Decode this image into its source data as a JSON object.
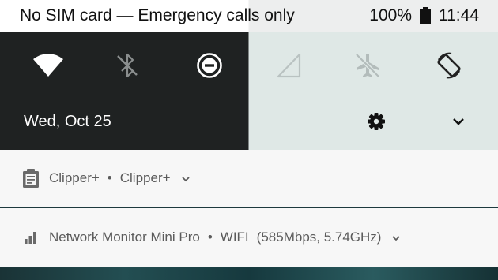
{
  "status_bar": {
    "carrier_text": "No SIM card — Emergency calls only",
    "battery_percent": "100%",
    "time": "11:44"
  },
  "quick_settings": {
    "tiles": [
      {
        "icon": "wifi-icon",
        "active": true
      },
      {
        "icon": "bluetooth-off-icon",
        "active": false
      },
      {
        "icon": "do-not-disturb-icon",
        "active": true
      },
      {
        "icon": "cellular-signal-icon",
        "active": false
      },
      {
        "icon": "airplane-mode-off-icon",
        "active": false
      },
      {
        "icon": "auto-rotate-icon",
        "active": true
      }
    ],
    "date": "Wed, Oct 25",
    "settings_icon": "gear-icon",
    "expand_icon": "chevron-down-icon"
  },
  "notifications": [
    {
      "icon": "clipboard-icon",
      "app_name": "Clipper+",
      "separator": "•",
      "title": "Clipper+",
      "expand_icon": "chevron-down-icon"
    },
    {
      "icon": "signal-bars-icon",
      "app_name": "Network Monitor Mini Pro",
      "separator": "•",
      "title": "WIFI",
      "detail": "(585Mbps, 5.74GHz)",
      "expand_icon": "chevron-down-icon"
    }
  ],
  "colors": {
    "qs_dark": "#1f2222",
    "qs_light": "#dfe8e6",
    "notification_bg": "#f7f7f7",
    "text_secondary": "#5b5b5b"
  }
}
